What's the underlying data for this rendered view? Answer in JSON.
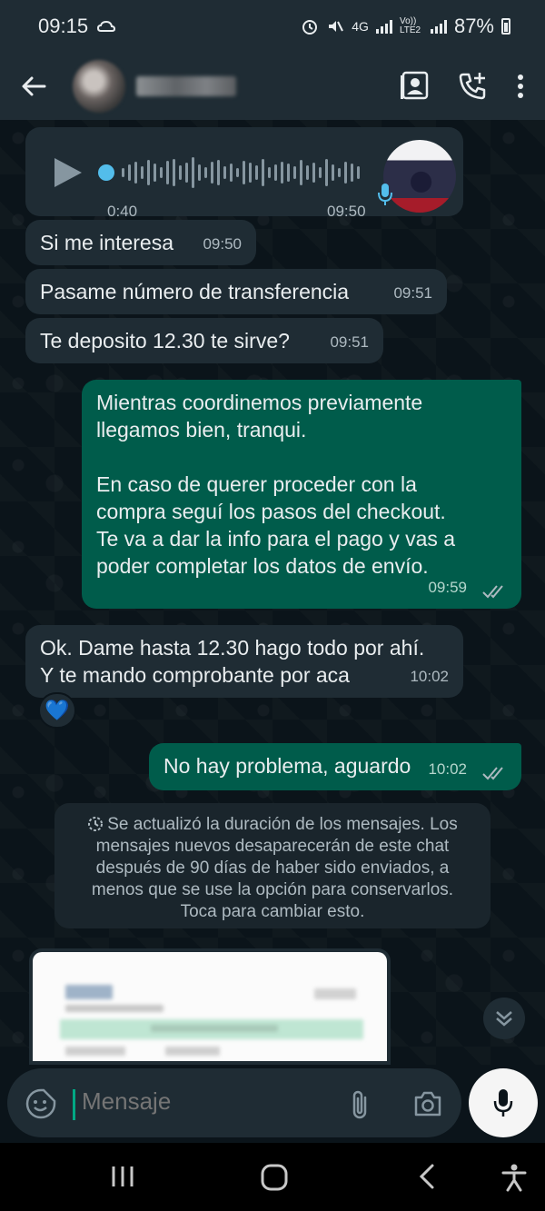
{
  "status_bar": {
    "time": "09:15",
    "network": "4G",
    "volte": "Vo)) LTE2",
    "battery": "87%"
  },
  "header": {
    "contact_name": "",
    "actions": [
      "contact-card-icon",
      "add-call-icon",
      "more-vert-icon"
    ]
  },
  "messages": {
    "voice": {
      "duration": "0:40",
      "time": "09:50"
    },
    "m1": {
      "text": "Si me interesa",
      "time": "09:50"
    },
    "m2": {
      "text": "Pasame número de transferencia",
      "time": "09:51"
    },
    "m3": {
      "text": "Te deposito 12.30 te sirve?",
      "time": "09:51"
    },
    "m4": {
      "line1": "Mientras coordinemos previamente",
      "line2": "llegamos bien, tranqui.",
      "line3": "En caso de querer proceder con la",
      "line4": "compra seguí los pasos del checkout.",
      "line5": "Te va a dar la info para el pago y vas a",
      "line6": "poder completar los datos de envío.",
      "time": "09:59"
    },
    "m5": {
      "line1": "Ok. Dame hasta 12.30 hago todo por ahí.",
      "line2": "Y te mando comprobante por aca",
      "time": "10:02",
      "reaction": "💙"
    },
    "m6": {
      "text": "No hay problema, aguardo",
      "time": "10:02"
    }
  },
  "system_note": {
    "line1": "Se actualizó la duración de los mensajes. Los",
    "line2": "mensajes nuevos desaparecerán de este chat",
    "line3": "después de 90 días de haber sido enviados, a",
    "line4": "menos que se use la opción para conservarlos.",
    "line5": "Toca para cambiar esto."
  },
  "input": {
    "placeholder": "Mensaje"
  },
  "colors": {
    "incoming": "#1f2c34",
    "outgoing": "#005c4b",
    "accent": "#00a884",
    "read_tick": "#aebac1"
  }
}
